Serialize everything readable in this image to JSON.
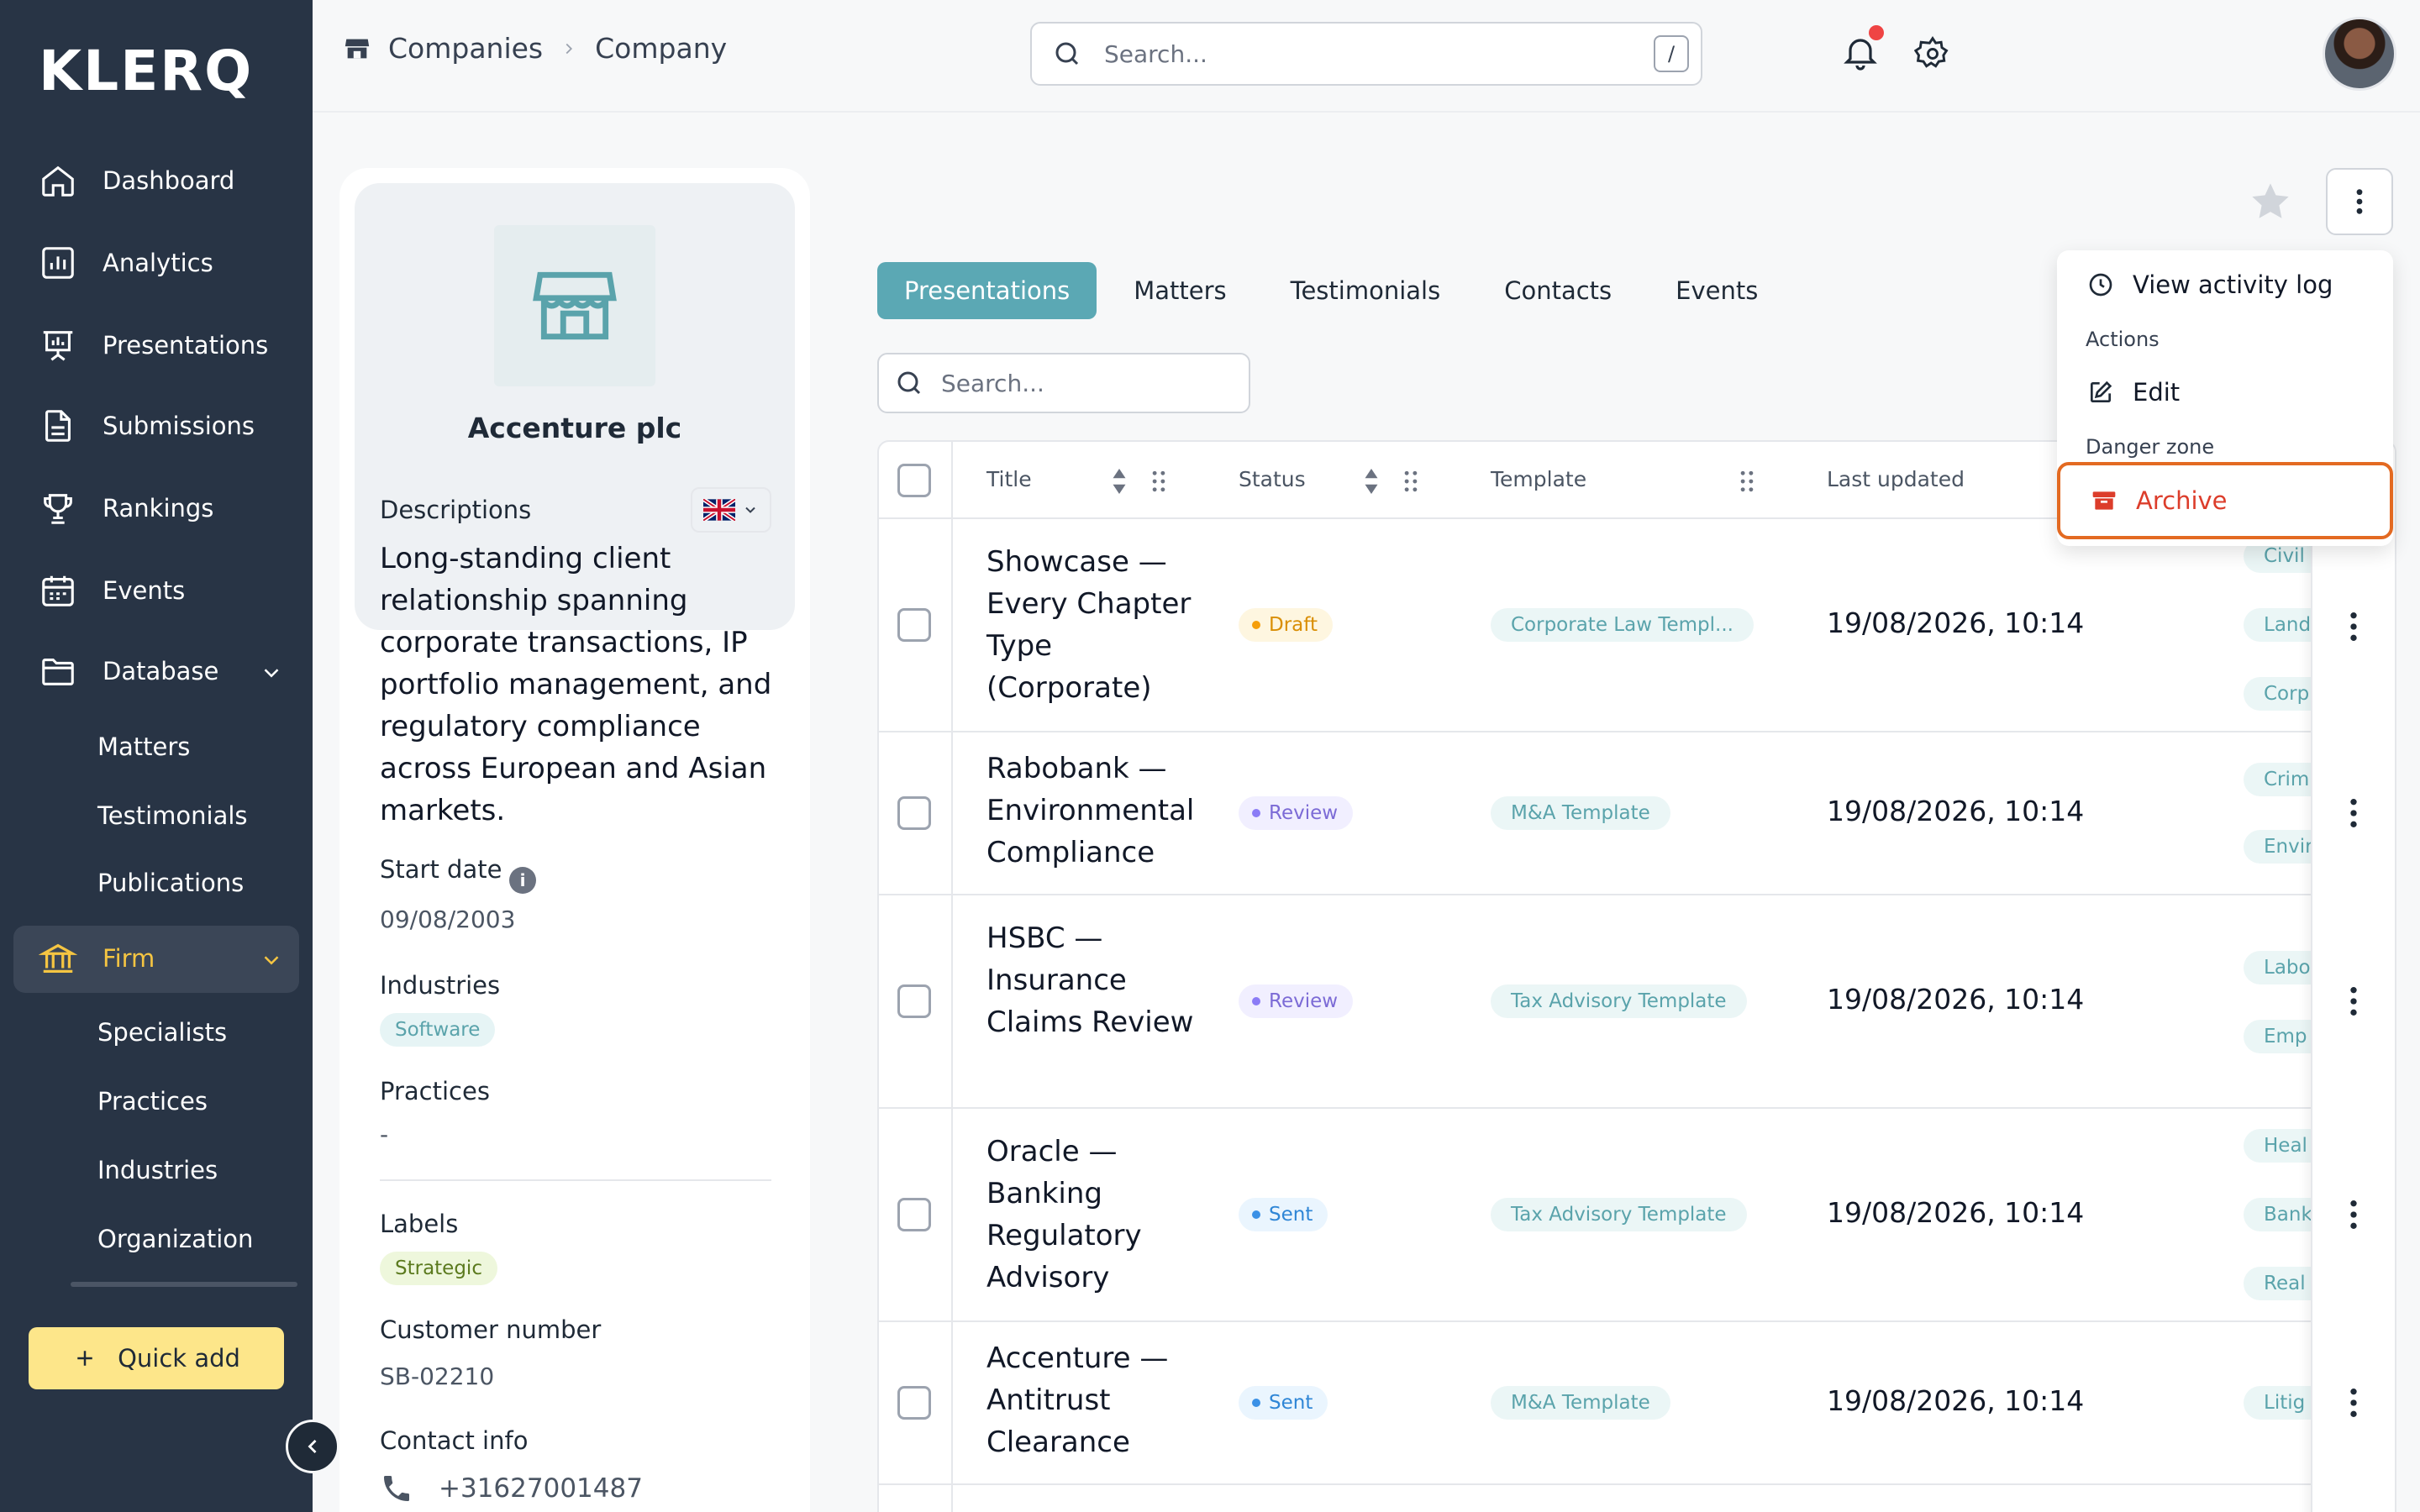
{
  "app": {
    "logo": "KLERQ"
  },
  "sidebar": {
    "items": [
      {
        "label": "Dashboard",
        "icon": "home-icon"
      },
      {
        "label": "Analytics",
        "icon": "analytics-icon"
      },
      {
        "label": "Presentations",
        "icon": "presentation-icon"
      },
      {
        "label": "Submissions",
        "icon": "document-icon"
      },
      {
        "label": "Rankings",
        "icon": "trophy-icon"
      },
      {
        "label": "Events",
        "icon": "calendar-icon"
      },
      {
        "label": "Database",
        "icon": "folder-icon"
      },
      {
        "label": "Firm",
        "icon": "bank-icon"
      }
    ],
    "database_sub": [
      "Matters",
      "Testimonials",
      "Publications"
    ],
    "firm_sub": [
      "Specialists",
      "Practices",
      "Industries",
      "Organization"
    ],
    "quick_add": "Quick add"
  },
  "header": {
    "breadcrumb": [
      "Companies",
      "Company"
    ],
    "search_placeholder": "Search...",
    "search_shortcut": "/"
  },
  "company": {
    "name": "Accenture plc",
    "descriptions_label": "Descriptions",
    "description": "Long-standing client relationship spanning corporate transactions, IP portfolio management, and regulatory compliance across European and Asian markets.",
    "start_date_label": "Start date",
    "start_date": "09/08/2003",
    "industries_label": "Industries",
    "industries": [
      "Software"
    ],
    "practices_label": "Practices",
    "practices": "-",
    "labels_label": "Labels",
    "labels": [
      "Strategic"
    ],
    "customer_number_label": "Customer number",
    "customer_number": "SB-02210",
    "contact_info_label": "Contact info",
    "phone": "+31627001487"
  },
  "tabs": [
    "Presentations",
    "Matters",
    "Testimonials",
    "Contacts",
    "Events"
  ],
  "table": {
    "search_placeholder": "Search...",
    "columns": [
      "Title",
      "Status",
      "Template",
      "Last updated"
    ],
    "rows": [
      {
        "title": "Showcase — Every Chapter Type (Corporate)",
        "status": "Draft",
        "template": "Corporate Law Templ...",
        "updated": "19/08/2026, 10:14",
        "practices": [
          "Civil",
          "Land",
          "Corp"
        ]
      },
      {
        "title": "Rabobank — Environmental Compliance",
        "status": "Review",
        "template": "M&A Template",
        "updated": "19/08/2026, 10:14",
        "practices": [
          "Crim",
          "Envir"
        ]
      },
      {
        "title": "HSBC — Insurance Claims Review",
        "status": "Review",
        "template": "Tax Advisory Template",
        "updated": "19/08/2026, 10:14",
        "practices": [
          "Labo",
          "Emp"
        ]
      },
      {
        "title": "Oracle — Banking Regulatory Advisory",
        "status": "Sent",
        "template": "Tax Advisory Template",
        "updated": "19/08/2026, 10:14",
        "practices": [
          "Heal",
          "Bank",
          "Real"
        ]
      },
      {
        "title": "Accenture — Antitrust Clearance",
        "status": "Sent",
        "template": "M&A Template",
        "updated": "19/08/2026, 10:14",
        "practices": [
          "Litig"
        ]
      }
    ]
  },
  "dropdown": {
    "view_activity_log": "View activity log",
    "actions_section": "Actions",
    "edit": "Edit",
    "danger_section": "Danger zone",
    "archive": "Archive"
  }
}
